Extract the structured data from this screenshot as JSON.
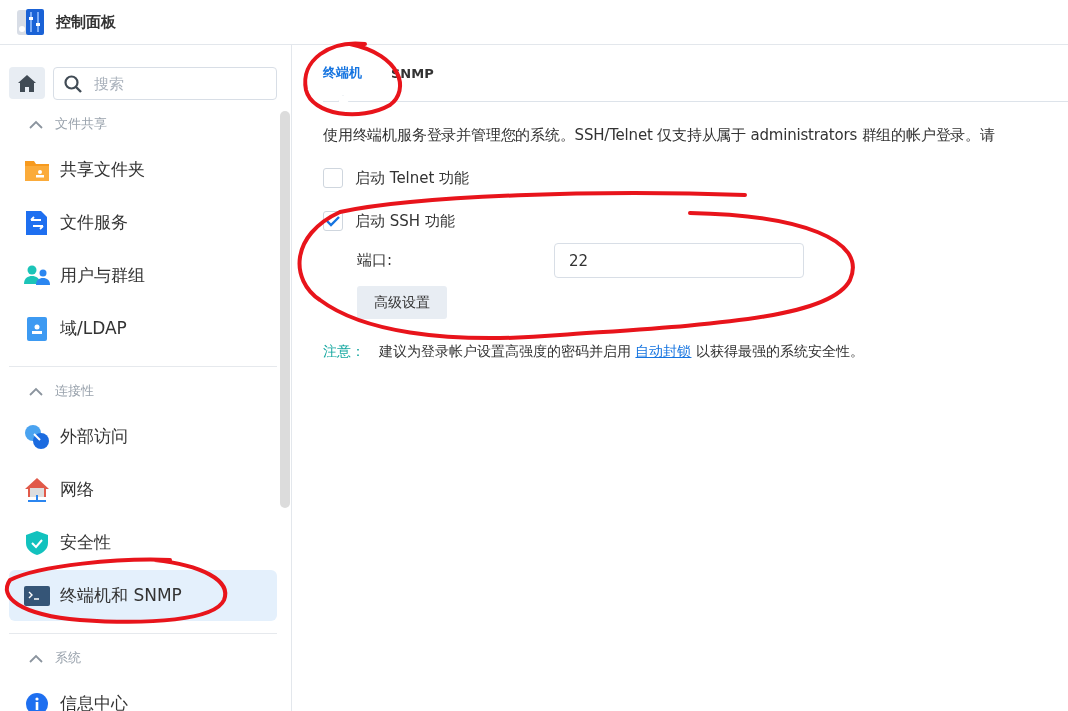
{
  "window": {
    "title": "控制面板"
  },
  "sidebar": {
    "search": {
      "placeholder": "搜索"
    },
    "sections": [
      {
        "title": "文件共享",
        "expanded": true,
        "items": [
          {
            "label": "共享文件夹",
            "kind": "folder",
            "selected": false
          },
          {
            "label": "文件服务",
            "kind": "file-service",
            "selected": false
          },
          {
            "label": "用户与群组",
            "kind": "users",
            "selected": false
          },
          {
            "label": "域/LDAP",
            "kind": "directory",
            "selected": false
          }
        ]
      },
      {
        "title": "连接性",
        "expanded": true,
        "items": [
          {
            "label": "外部访问",
            "kind": "external",
            "selected": false
          },
          {
            "label": "网络",
            "kind": "network",
            "selected": false
          },
          {
            "label": "安全性",
            "kind": "shield",
            "selected": false
          },
          {
            "label": "终端机和 SNMP",
            "kind": "terminal",
            "selected": true
          }
        ]
      },
      {
        "title": "系统",
        "expanded": true,
        "items": [
          {
            "label": "信息中心",
            "kind": "info",
            "selected": false
          }
        ]
      }
    ]
  },
  "tabs": [
    {
      "label": "终端机",
      "selected": true
    },
    {
      "label": "SNMP",
      "selected": false
    }
  ],
  "description": "使用终端机服务登录并管理您的系统。SSH/Telnet 仅支持从属于 administrators 群组的帐户登录。请",
  "options": [
    {
      "label": "启动 Telnet 功能",
      "checked": false
    },
    {
      "label": "启动 SSH 功能",
      "checked": true
    }
  ],
  "port": {
    "label": "端口:",
    "value": "22"
  },
  "advanced_button": "高级设置",
  "note": {
    "label": "注意：",
    "text_before": "建议为登录帐户设置高强度的密码并启用 ",
    "link": "自动封锁",
    "text_after": " 以获得最强的系统安全性。"
  },
  "annotations": [
    {
      "kind": "circle"
    },
    {
      "kind": "circle"
    },
    {
      "kind": "circle"
    }
  ]
}
